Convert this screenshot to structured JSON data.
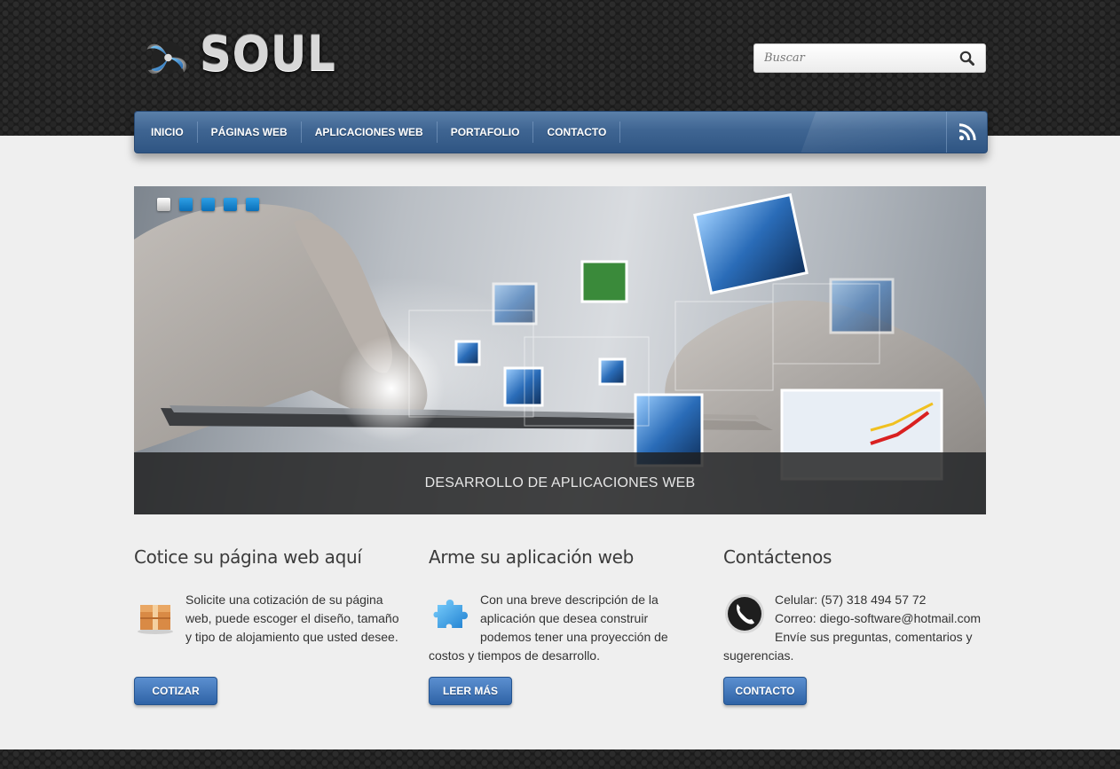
{
  "brand": {
    "name": "SOUL"
  },
  "search": {
    "placeholder": "Buscar",
    "icon": "search-icon"
  },
  "nav": {
    "items": [
      {
        "label": "INICIO"
      },
      {
        "label": "PÁGINAS WEB"
      },
      {
        "label": "APLICACIONES WEB"
      },
      {
        "label": "PORTAFOLIO"
      },
      {
        "label": "CONTACTO"
      }
    ],
    "rss_icon": "rss-icon"
  },
  "slider": {
    "caption": "DESARROLLO DE APLICACIONES WEB",
    "slide_count": 5,
    "active_index": 0
  },
  "columns": {
    "quote": {
      "title": "Cotice su página web aquí",
      "text": "Solicite una cotización de su página web, puede escoger el diseño, tamaño y tipo de alojamiento que usted desee.",
      "button": "COTIZAR",
      "icon": "box-icon"
    },
    "app": {
      "title": "Arme su aplicación web",
      "text": "Con una breve descripción de la aplicación que desea construir podemos tener una proyección de costos y tiempos de desarrollo.",
      "button": "LEER MÁS",
      "icon": "puzzle-icon"
    },
    "contact": {
      "title": "Contáctenos",
      "line1": "Celular: (57) 318 494 57 72",
      "line2": "Correo: diego-software@hotmail.com",
      "line3": "Envíe sus preguntas, comentarios y sugerencias.",
      "button": "CONTACTO",
      "icon": "phone-icon"
    }
  },
  "colors": {
    "nav": "#3f6592",
    "button": "#3a70b5",
    "dot": "#1a8ad6",
    "background": "#efefef",
    "header": "#1b1b1b"
  }
}
